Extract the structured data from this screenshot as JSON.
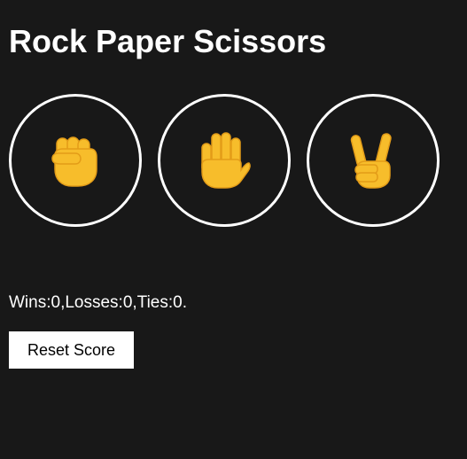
{
  "title": "Rock Paper Scissors",
  "moves": [
    {
      "name": "rock",
      "icon": "raised-fist-icon"
    },
    {
      "name": "paper",
      "icon": "raised-hand-icon"
    },
    {
      "name": "scissors",
      "icon": "victory-hand-icon"
    }
  ],
  "score": {
    "text": "Wins:0,Losses:0,Ties:0."
  },
  "reset_label": "Reset Score",
  "colors": {
    "background": "#181818",
    "text": "#ffffff",
    "circle_border": "#ffffff",
    "emoji": "#f7bd2b",
    "button_bg": "#ffffff",
    "button_text": "#000000"
  }
}
